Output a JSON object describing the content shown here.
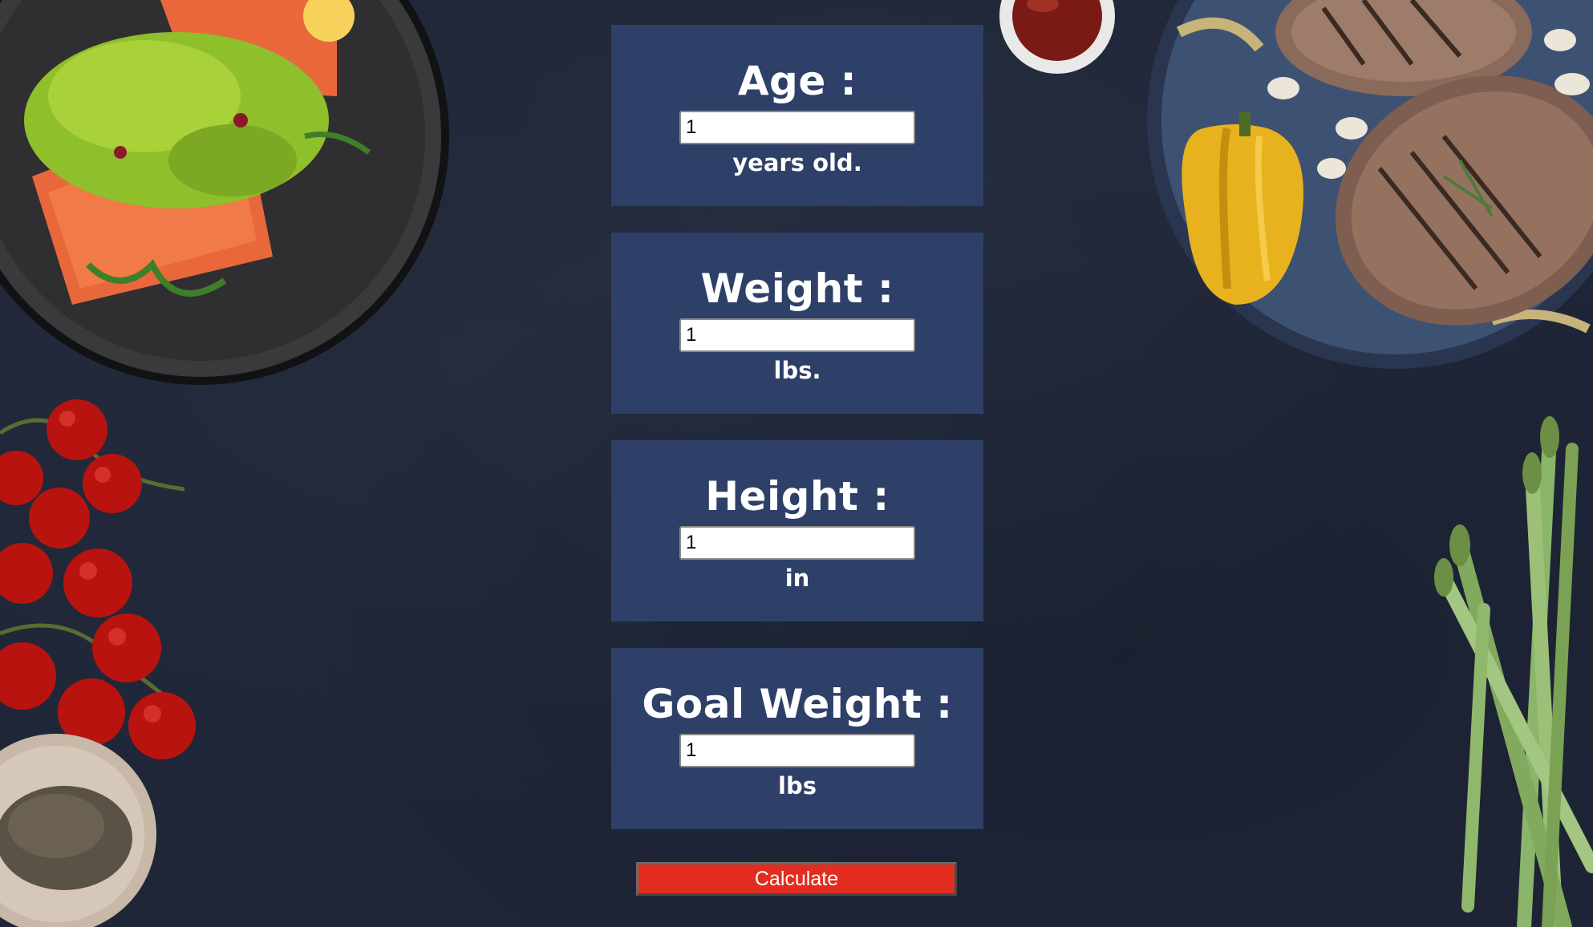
{
  "fields": [
    {
      "label": "Age :",
      "value": "1",
      "unit": "years old."
    },
    {
      "label": "Weight :",
      "value": "1",
      "unit": "lbs."
    },
    {
      "label": "Height :",
      "value": "1",
      "unit": "in"
    },
    {
      "label": "Goal Weight :",
      "value": "1",
      "unit": "lbs"
    }
  ],
  "calculate_label": "Calculate",
  "colors": {
    "background": "#1f2638",
    "card": "#2e4068",
    "button": "#e22c20"
  },
  "decorations": [
    "salmon-avocado-plate",
    "ketchup-bowl",
    "steak-pepper-plate",
    "cherry-tomatoes",
    "pepper-bowl",
    "asparagus"
  ]
}
